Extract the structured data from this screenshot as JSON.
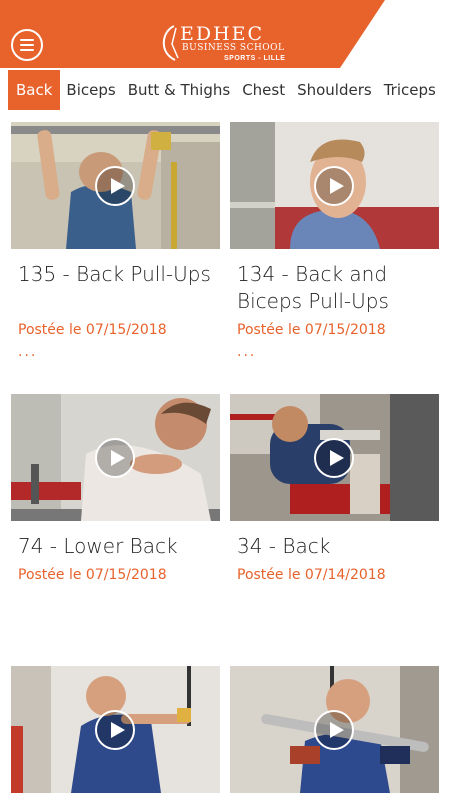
{
  "header": {
    "brand_name": "EDHEC",
    "brand_school": "BUSINESS SCHOOL",
    "brand_sub": "SPORTS - LILLE",
    "menu_icon": "hamburger-menu-icon",
    "accent_color": "#e8622c"
  },
  "tabs": [
    {
      "label": "Back",
      "active": true
    },
    {
      "label": "Biceps",
      "active": false
    },
    {
      "label": "Butt & Thighs",
      "active": false
    },
    {
      "label": "Chest",
      "active": false
    },
    {
      "label": "Shoulders",
      "active": false
    },
    {
      "label": "Triceps",
      "active": false
    }
  ],
  "videos": [
    {
      "title": "135 - Back Pull-Ups",
      "date": "Postée le 07/15/2018",
      "more": "..."
    },
    {
      "title": "134 - Back and Biceps Pull-Ups",
      "date": "Postée le 07/15/2018",
      "more": "..."
    },
    {
      "title": "74 - Lower Back",
      "date": "Postée le 07/15/2018"
    },
    {
      "title": "34 - Back",
      "date": "Postée le 07/14/2018"
    },
    {
      "title": "",
      "date": ""
    },
    {
      "title": "",
      "date": ""
    }
  ]
}
